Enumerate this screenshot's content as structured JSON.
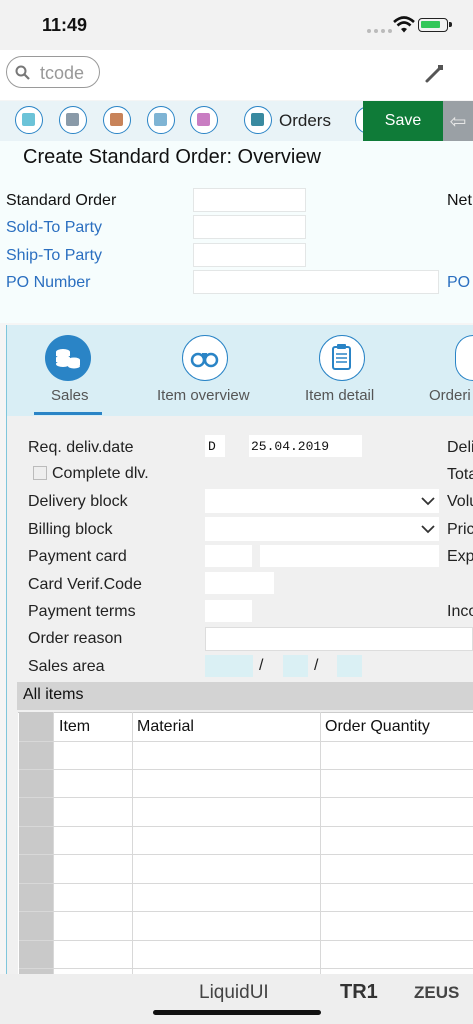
{
  "status_bar": {
    "time": "11:49"
  },
  "search": {
    "placeholder": "tcode"
  },
  "toolbar": {
    "orders_label": "Orders",
    "save_label": "Save"
  },
  "header": {
    "title": "Create Standard Order: Overview",
    "standard_order_label": "Standard Order",
    "sold_to_label": "Sold-To Party",
    "ship_to_label": "Ship-To Party",
    "po_number_label": "PO Number",
    "net_label_partial": "Net",
    "po_label_partial": "PO"
  },
  "tabs": [
    {
      "label": "Sales",
      "icon": "coins-icon"
    },
    {
      "label": "Item overview",
      "icon": "binoculars-icon"
    },
    {
      "label": "Item detail",
      "icon": "clipboard-icon"
    },
    {
      "label": "Orderi",
      "icon": "partial-tab-icon"
    }
  ],
  "sales": {
    "req_deliv_label": "Req. deliv.date",
    "req_deliv_type": "D",
    "req_deliv_date": "25.04.2019",
    "complete_dlv_label": "Complete dlv.",
    "delivery_block_label": "Delivery block",
    "billing_block_label": "Billing block",
    "payment_card_label": "Payment card",
    "card_verif_label": "Card Verif.Code",
    "payment_terms_label": "Payment terms",
    "order_reason_label": "Order reason",
    "sales_area_label": "Sales area",
    "slash": "/",
    "right_labels": [
      "Deli",
      "Tota",
      "Volu",
      "Pric",
      "Exp",
      "Inco"
    ]
  },
  "items": {
    "title": "All items",
    "columns": [
      "Item",
      "Material",
      "Order Quantity"
    ]
  },
  "bottom_bar": {
    "app": "LiquidUI",
    "system": "TR1",
    "server": "ZEUS"
  },
  "colors": {
    "save_green": "#0f7b38",
    "accent_blue": "#2a84c6",
    "link_blue": "#2b6fc0"
  }
}
